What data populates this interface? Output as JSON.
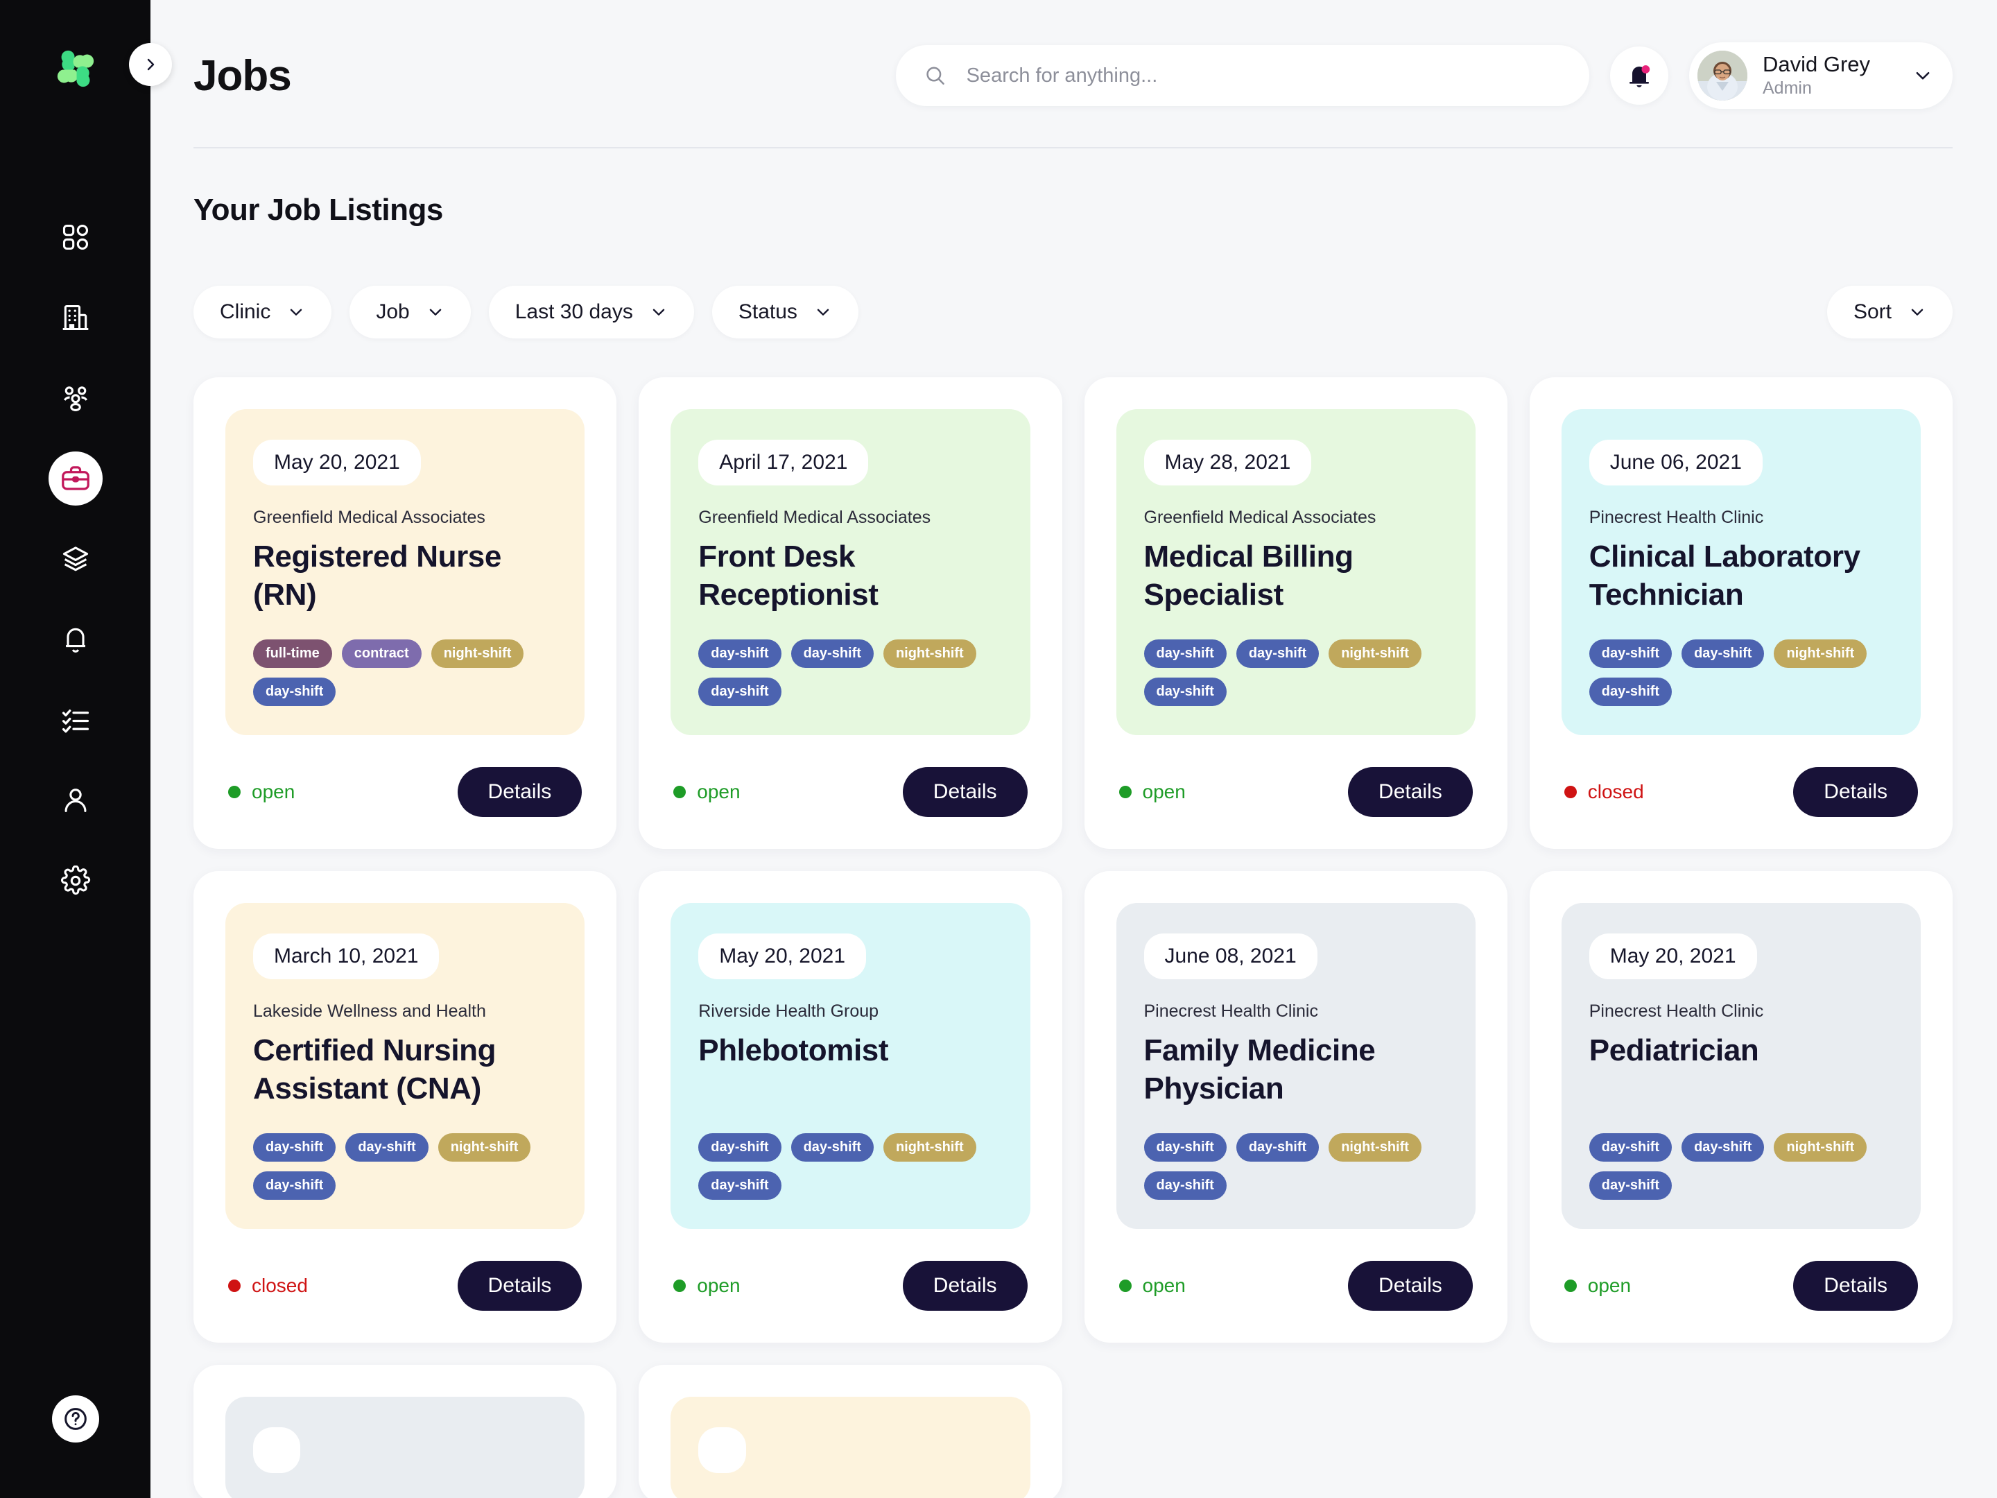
{
  "app": {
    "logo_icon": "clover-logo-icon",
    "collapse_icon": "chevron-right-icon",
    "help_icon": "question-circle-icon"
  },
  "sidebar": {
    "items": [
      {
        "icon": "grid-dashboard-icon",
        "name": "dashboard",
        "active": false
      },
      {
        "icon": "building-clinic-icon",
        "name": "clinics",
        "active": false
      },
      {
        "icon": "people-group-icon",
        "name": "staff",
        "active": false
      },
      {
        "icon": "briefcase-icon",
        "name": "jobs",
        "active": true
      },
      {
        "icon": "layers-stack-icon",
        "name": "layers",
        "active": false
      },
      {
        "icon": "bell-icon",
        "name": "notifications",
        "active": false
      },
      {
        "icon": "checklist-icon",
        "name": "tasks",
        "active": false
      },
      {
        "icon": "user-profile-icon",
        "name": "profile",
        "active": false
      },
      {
        "icon": "gear-settings-icon",
        "name": "settings",
        "active": false
      }
    ]
  },
  "header": {
    "title": "Jobs",
    "search": {
      "placeholder": "Search for anything...",
      "value": "",
      "icon": "search-icon"
    },
    "notification": {
      "icon": "bell-icon",
      "has_badge": true,
      "badge_color": "#e8227a"
    },
    "user": {
      "name": "David Grey",
      "role": "Admin",
      "avatar_icon": "user-avatar",
      "chevron_icon": "chevron-down-icon"
    }
  },
  "main": {
    "section_title": "Your Job Listings",
    "filters": [
      {
        "label": "Clinic",
        "icon": "chevron-down-icon"
      },
      {
        "label": "Job",
        "icon": "chevron-down-icon"
      },
      {
        "label": "Last 30 days",
        "icon": "chevron-down-icon"
      },
      {
        "label": "Status",
        "icon": "chevron-down-icon"
      }
    ],
    "sort": {
      "label": "Sort",
      "icon": "chevron-down-icon"
    },
    "details_label": "Details",
    "status_colors": {
      "open": "#1e9c27",
      "closed": "#cf1313"
    },
    "tag_colors": {
      "full-time": "#7d5270",
      "contract": "#7e6cad",
      "night-shift": "#c0a85c",
      "day-shift": "#4c63b0"
    },
    "card_backgrounds": {
      "cream": "#fdf3dd",
      "green": "#e6f8df",
      "cyan": "#d9f7f8",
      "grey": "#e9edf1"
    },
    "cards": [
      {
        "date": "May 20, 2021",
        "company": "Greenfield Medical Associates",
        "title": "Registered Nurse (RN)",
        "tags": [
          "full-time",
          "contract",
          "night-shift",
          "day-shift"
        ],
        "status": "open",
        "bg": "cream"
      },
      {
        "date": "April 17, 2021",
        "company": "Greenfield Medical Associates",
        "title": "Front Desk Receptionist",
        "tags": [
          "day-shift",
          "day-shift",
          "night-shift",
          "day-shift"
        ],
        "status": "open",
        "bg": "green"
      },
      {
        "date": "May 28, 2021",
        "company": "Greenfield Medical Associates",
        "title": "Medical Billing Specialist",
        "tags": [
          "day-shift",
          "day-shift",
          "night-shift",
          "day-shift"
        ],
        "status": "open",
        "bg": "green"
      },
      {
        "date": "June 06, 2021",
        "company": "Pinecrest Health Clinic",
        "title": "Clinical Laboratory Technician",
        "tags": [
          "day-shift",
          "day-shift",
          "night-shift",
          "day-shift"
        ],
        "status": "closed",
        "bg": "cyan"
      },
      {
        "date": "March 10, 2021",
        "company": "Lakeside Wellness and Health",
        "title": "Certified Nursing Assistant (CNA)",
        "tags": [
          "day-shift",
          "day-shift",
          "night-shift",
          "day-shift"
        ],
        "status": "closed",
        "bg": "cream"
      },
      {
        "date": "May 20, 2021",
        "company": "Riverside Health Group",
        "title": "Phlebotomist",
        "tags": [
          "day-shift",
          "day-shift",
          "night-shift",
          "day-shift"
        ],
        "status": "open",
        "bg": "cyan"
      },
      {
        "date": "June 08, 2021",
        "company": "Pinecrest Health Clinic",
        "title": "Family Medicine Physician",
        "tags": [
          "day-shift",
          "day-shift",
          "night-shift",
          "day-shift"
        ],
        "status": "open",
        "bg": "grey"
      },
      {
        "date": "May 20, 2021",
        "company": "Pinecrest Health Clinic",
        "title": "Pediatrician",
        "tags": [
          "day-shift",
          "day-shift",
          "night-shift",
          "day-shift"
        ],
        "status": "open",
        "bg": "grey"
      }
    ],
    "partial_cards": [
      {
        "bg": "grey"
      },
      {
        "bg": "cream"
      }
    ]
  }
}
